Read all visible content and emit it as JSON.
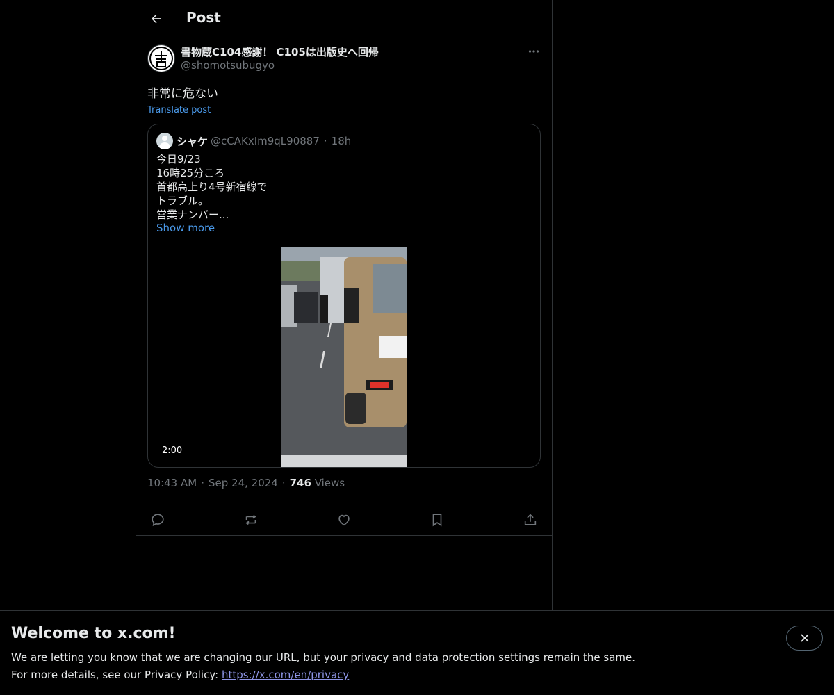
{
  "header": {
    "title": "Post",
    "back_icon": "arrow-left-icon"
  },
  "post": {
    "author_name": "書物蔵C104感謝！ C105は出版史へ回帰",
    "author_handle": "@shomotsubugyo",
    "text": "非常に危ない",
    "translate_label": "Translate post",
    "time": "10:43 AM",
    "date": "Sep 24, 2024",
    "views_count": "746",
    "views_label": "Views"
  },
  "quote": {
    "name": "シャケ",
    "handle": "@cCAKxIm9qL90887",
    "time": "18h",
    "lines": [
      "今日9/23",
      "16時25分ころ",
      "首都高上り4号新宿線で",
      "トラブル。",
      "営業ナンバー..."
    ],
    "show_more": "Show more",
    "video_duration": "2:00"
  },
  "actions": [
    "reply-icon",
    "repost-icon",
    "like-icon",
    "bookmark-icon",
    "share-icon"
  ],
  "banner": {
    "title": "Welcome to x.com!",
    "line1": "We are letting you know that we are changing our URL, but your privacy and data protection settings remain the same.",
    "line2_prefix": "For more details, see our Privacy Policy: ",
    "link": "https://x.com/en/privacy"
  },
  "colors": {
    "background": "#000000",
    "text": "#e7e9ea",
    "muted": "#71767b",
    "link": "#4a99e9",
    "border": "#2f3336"
  }
}
